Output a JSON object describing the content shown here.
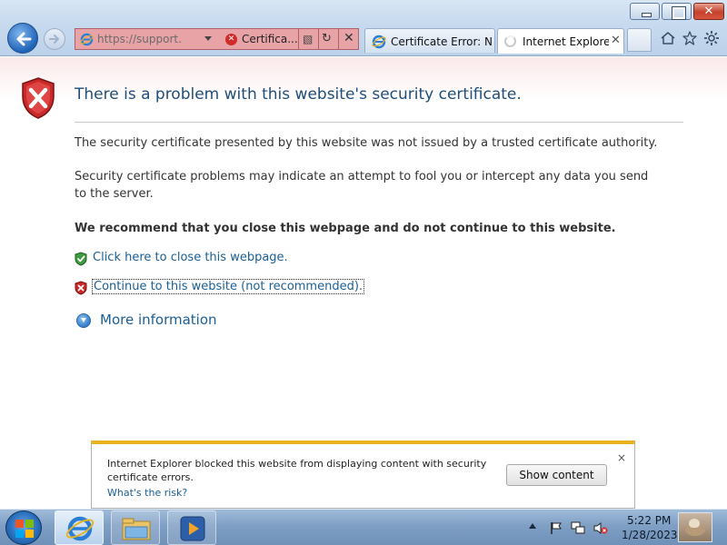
{
  "browser": {
    "address": {
      "url_text": "https://support.m",
      "error_label": "Certifica..."
    },
    "tabs": [
      {
        "label": "Certificate Error: N...",
        "active": false
      },
      {
        "label": "Internet Explore...",
        "active": true
      }
    ],
    "accent_error": "#e8a3a7",
    "icons": [
      "back-icon",
      "forward-icon",
      "ie-icon",
      "refresh-icon",
      "stop-icon",
      "home-icon",
      "favorites-icon",
      "tools-icon"
    ]
  },
  "page": {
    "headline": "There is a problem with this website's security certificate.",
    "para1": "The security certificate presented by this website was not issued by a trusted certificate authority.",
    "para2": "Security certificate problems may indicate an attempt to fool you or intercept any data you send to the server.",
    "recommendation": "We recommend that you close this webpage and do not continue to this website.",
    "close_link": "Click here to close this webpage.",
    "continue_link": "Continue to this website (not recommended).",
    "more_info": "More information"
  },
  "notification": {
    "message": "Internet Explorer blocked this website from displaying content with security certificate errors.",
    "risk_link": "What's the risk?",
    "button": "Show content",
    "close": "×"
  },
  "taskbar": {
    "time": "5:22 PM",
    "date": "1/28/2023"
  }
}
